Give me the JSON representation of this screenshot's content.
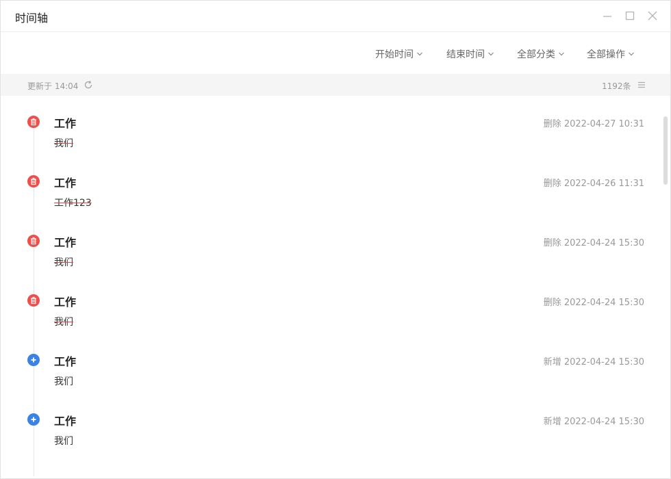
{
  "window": {
    "title": "时间轴"
  },
  "filters": [
    {
      "label": "开始时间"
    },
    {
      "label": "结束时间"
    },
    {
      "label": "全部分类"
    },
    {
      "label": "全部操作"
    }
  ],
  "status": {
    "updated": "更新于 14:04",
    "count": "1192条"
  },
  "entries": [
    {
      "type": "delete",
      "category": "工作",
      "meta": "删除 2022-04-27 10:31",
      "content": "我们",
      "strikethrough": true
    },
    {
      "type": "delete",
      "category": "工作",
      "meta": "删除 2022-04-26 11:31",
      "content": "工作123",
      "strikethrough": true
    },
    {
      "type": "delete",
      "category": "工作",
      "meta": "删除 2022-04-24 15:30",
      "content": "我们",
      "strikethrough": true
    },
    {
      "type": "delete",
      "category": "工作",
      "meta": "删除 2022-04-24 15:30",
      "content": "我们",
      "strikethrough": true
    },
    {
      "type": "add",
      "category": "工作",
      "meta": "新增 2022-04-24 15:30",
      "content": "我们",
      "strikethrough": false
    },
    {
      "type": "add",
      "category": "工作",
      "meta": "新增 2022-04-24 15:30",
      "content": "我们",
      "strikethrough": false
    }
  ],
  "colors": {
    "delete": "#ee4f4b",
    "add": "#3b82e6",
    "status_bg": "#f5f5f5"
  },
  "icons": {
    "delete": "trash-icon",
    "add": "plus-icon",
    "refresh": "refresh-icon",
    "list": "menu-icon",
    "filter": "chevron-down-icon"
  }
}
